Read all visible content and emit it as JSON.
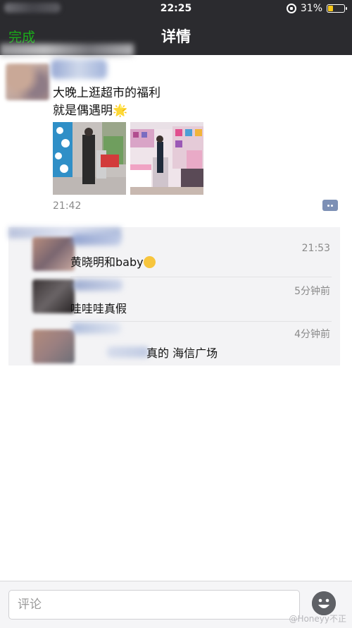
{
  "status_bar": {
    "time": "22:25",
    "battery": "31%",
    "battery_level": 0.31
  },
  "nav": {
    "done_label": "完成",
    "title": "详情"
  },
  "post": {
    "text_line1": "大晚上逛超市的福利",
    "text_line2": "就是偶遇明",
    "emoji": "🌟",
    "time": "21:42",
    "photos": [
      "photo-1",
      "photo-2"
    ]
  },
  "comments": [
    {
      "text": "黄晓明和baby",
      "emoji": "😂",
      "time": "21:53"
    },
    {
      "text": "哇哇哇真假",
      "time": "5分钟前"
    },
    {
      "text": "真的 海信广场",
      "time": "4分钟前"
    }
  ],
  "bottom": {
    "input_placeholder": "评论"
  },
  "watermark": "@Honeyy不正",
  "colors": {
    "accent_green": "#1aad19",
    "nav_bg": "#2b2b2f",
    "panel_bg": "#f3f3f5"
  },
  "icons": {
    "lock": "orientation-lock-icon",
    "battery": "battery-icon",
    "star": "star-icon",
    "comment": "comment-icon",
    "laugh": "laugh-emoji-icon",
    "emoji": "emoji-face-icon"
  }
}
